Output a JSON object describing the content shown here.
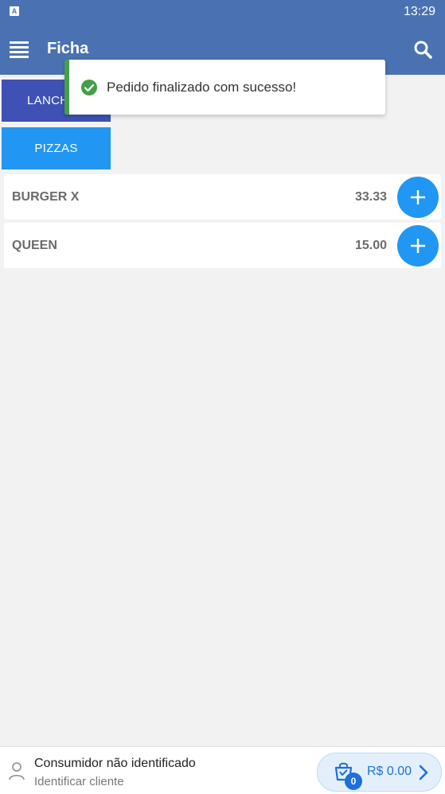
{
  "status_bar": {
    "badge": "A",
    "time": "13:29"
  },
  "app_bar": {
    "title": "Ficha"
  },
  "categories": [
    {
      "label": "LANCHES"
    },
    {
      "label": "PIZZAS"
    }
  ],
  "products": [
    {
      "name": "BURGER X",
      "price": "33.33"
    },
    {
      "name": "QUEEN",
      "price": "15.00"
    }
  ],
  "toast": {
    "message": "Pedido finalizado com sucesso!"
  },
  "footer": {
    "consumer_title": "Consumidor não identificado",
    "consumer_action": "Identificar cliente",
    "cart_count": "0",
    "cart_total": "R$ 0.00"
  },
  "colors": {
    "app_bar": "#4a72b2",
    "category_selected": "#3f51b5",
    "category": "#2196f3",
    "add_button": "#2196f3",
    "success": "#43a047",
    "cart_accent": "#1e6fd9"
  },
  "icons": [
    "menu-icon",
    "search-icon",
    "plus-icon",
    "check-circle-icon",
    "user-icon",
    "cart-icon",
    "chevron-right-icon"
  ]
}
